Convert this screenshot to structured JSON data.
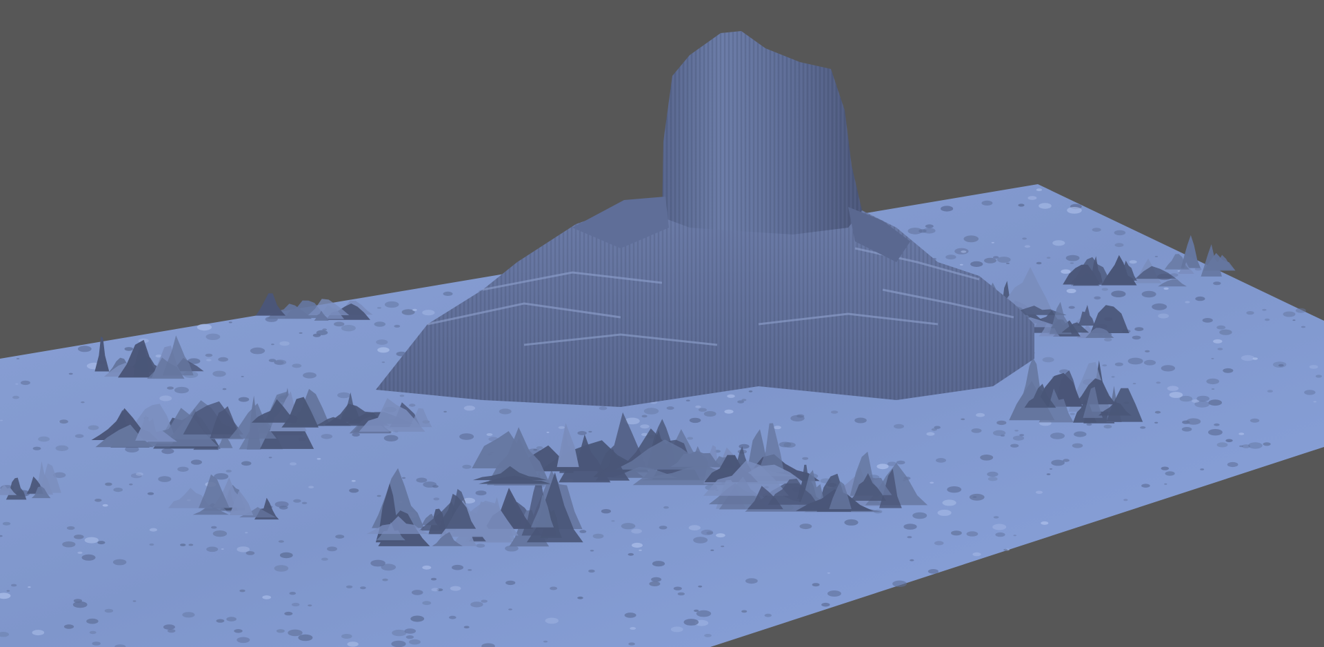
{
  "scene": {
    "subject": "terrain-render",
    "colors": {
      "background": "#575757",
      "plane_light": "#8ea6dc",
      "plane_mid": "#7f95c8",
      "plane_dark": "#5e6f99",
      "rock_light": "#7a8dbd",
      "rock_mid": "#65769f",
      "rock_dark": "#4a5678",
      "rock_shadow": "#3a4360"
    }
  }
}
